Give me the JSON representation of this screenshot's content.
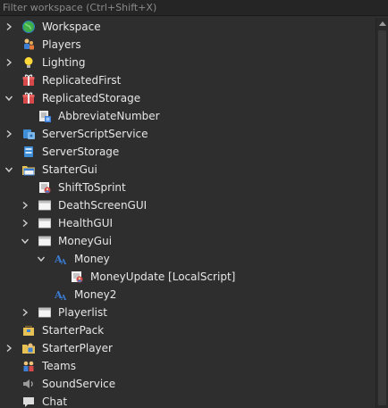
{
  "filter": {
    "placeholder": "Filter workspace (Ctrl+Shift+X)"
  },
  "tree": [
    {
      "label": "Workspace",
      "depth": 0,
      "chevron": "right",
      "icon": "globe-icon",
      "name": "tree-item-workspace"
    },
    {
      "label": "Players",
      "depth": 0,
      "chevron": "none",
      "icon": "players-icon",
      "name": "tree-item-players"
    },
    {
      "label": "Lighting",
      "depth": 0,
      "chevron": "right",
      "icon": "lightbulb-icon",
      "name": "tree-item-lighting"
    },
    {
      "label": "ReplicatedFirst",
      "depth": 0,
      "chevron": "none",
      "icon": "gift-box-icon",
      "name": "tree-item-replicatedfirst"
    },
    {
      "label": "ReplicatedStorage",
      "depth": 0,
      "chevron": "down",
      "icon": "gift-box-icon",
      "name": "tree-item-replicatedstorage"
    },
    {
      "label": "AbbreviateNumber",
      "depth": 1,
      "chevron": "none",
      "icon": "module-script-icon",
      "name": "tree-item-abbreviatenumber"
    },
    {
      "label": "ServerScriptService",
      "depth": 0,
      "chevron": "right",
      "icon": "server-script-icon",
      "name": "tree-item-serverscriptservice"
    },
    {
      "label": "ServerStorage",
      "depth": 0,
      "chevron": "none",
      "icon": "server-storage-icon",
      "name": "tree-item-serverstorage"
    },
    {
      "label": "StarterGui",
      "depth": 0,
      "chevron": "down",
      "icon": "folder-window-icon",
      "name": "tree-item-startergui"
    },
    {
      "label": "ShiftToSprint",
      "depth": 1,
      "chevron": "none",
      "icon": "local-script-icon",
      "name": "tree-item-shifttosprint"
    },
    {
      "label": "DeathScreenGUI",
      "depth": 1,
      "chevron": "right",
      "icon": "screengui-icon",
      "name": "tree-item-deathscreengui"
    },
    {
      "label": "HealthGUI",
      "depth": 1,
      "chevron": "right",
      "icon": "screengui-icon",
      "name": "tree-item-healthgui"
    },
    {
      "label": "MoneyGui",
      "depth": 1,
      "chevron": "down",
      "icon": "screengui-icon",
      "name": "tree-item-moneygui"
    },
    {
      "label": "Money",
      "depth": 2,
      "chevron": "down",
      "icon": "textlabel-icon",
      "name": "tree-item-money"
    },
    {
      "label": "MoneyUpdate [LocalScript]",
      "depth": 3,
      "chevron": "none",
      "icon": "local-script-icon",
      "name": "tree-item-moneyupdate"
    },
    {
      "label": "Money2",
      "depth": 2,
      "chevron": "none",
      "icon": "textlabel-icon",
      "name": "tree-item-money2"
    },
    {
      "label": "Playerlist",
      "depth": 1,
      "chevron": "right",
      "icon": "screengui-icon",
      "name": "tree-item-playerlist"
    },
    {
      "label": "StarterPack",
      "depth": 0,
      "chevron": "none",
      "icon": "starter-pack-icon",
      "name": "tree-item-starterpack"
    },
    {
      "label": "StarterPlayer",
      "depth": 0,
      "chevron": "right",
      "icon": "starter-player-icon",
      "name": "tree-item-starterplayer"
    },
    {
      "label": "Teams",
      "depth": 0,
      "chevron": "none",
      "icon": "teams-icon",
      "name": "tree-item-teams"
    },
    {
      "label": "SoundService",
      "depth": 0,
      "chevron": "none",
      "icon": "speaker-icon",
      "name": "tree-item-soundservice"
    },
    {
      "label": "Chat",
      "depth": 0,
      "chevron": "none",
      "icon": "chat-icon",
      "name": "tree-item-chat"
    }
  ]
}
